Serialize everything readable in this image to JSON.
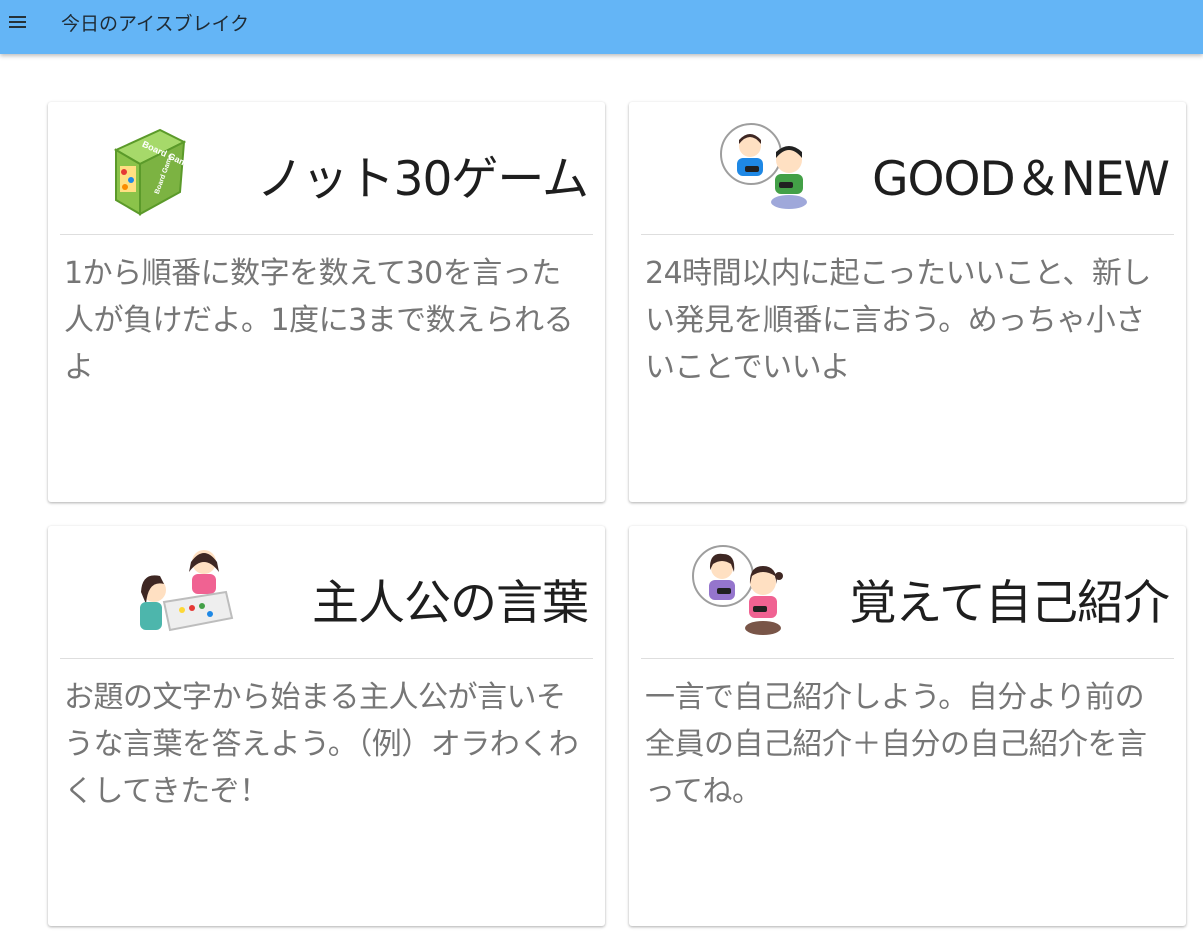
{
  "app": {
    "title": "今日のアイスブレイク"
  },
  "icons": {
    "menu": "hamburger-menu-icon",
    "card1": "board-game-box-icon",
    "card2": "two-kids-playing-game-icon",
    "card3": "two-girls-board-game-icon",
    "card4": "two-girls-introduction-icon"
  },
  "cards": [
    {
      "title": "ノット30ゲーム",
      "body": "1から順番に数字を数えて30を言った人が負けだよ。1度に3まで数えられるよ",
      "illustration_text": "Board Game"
    },
    {
      "title": "GOOD＆NEW",
      "body": "24時間以内に起こったいいこと、新しい発見を順番に言おう。めっちゃ小さいことでいいよ"
    },
    {
      "title": "主人公の言葉",
      "body": "お題の文字から始まる主人公が言いそうな言葉を答えよう。（例）オラわくわくしてきたぞ！"
    },
    {
      "title": "覚えて自己紹介",
      "body": "一言で自己紹介しよう。自分より前の全員の自己紹介＋自分の自己紹介を言ってね。"
    }
  ],
  "colors": {
    "appbar": "#64b5f6",
    "card_title": "#1e1e1e",
    "card_body": "#767676"
  }
}
